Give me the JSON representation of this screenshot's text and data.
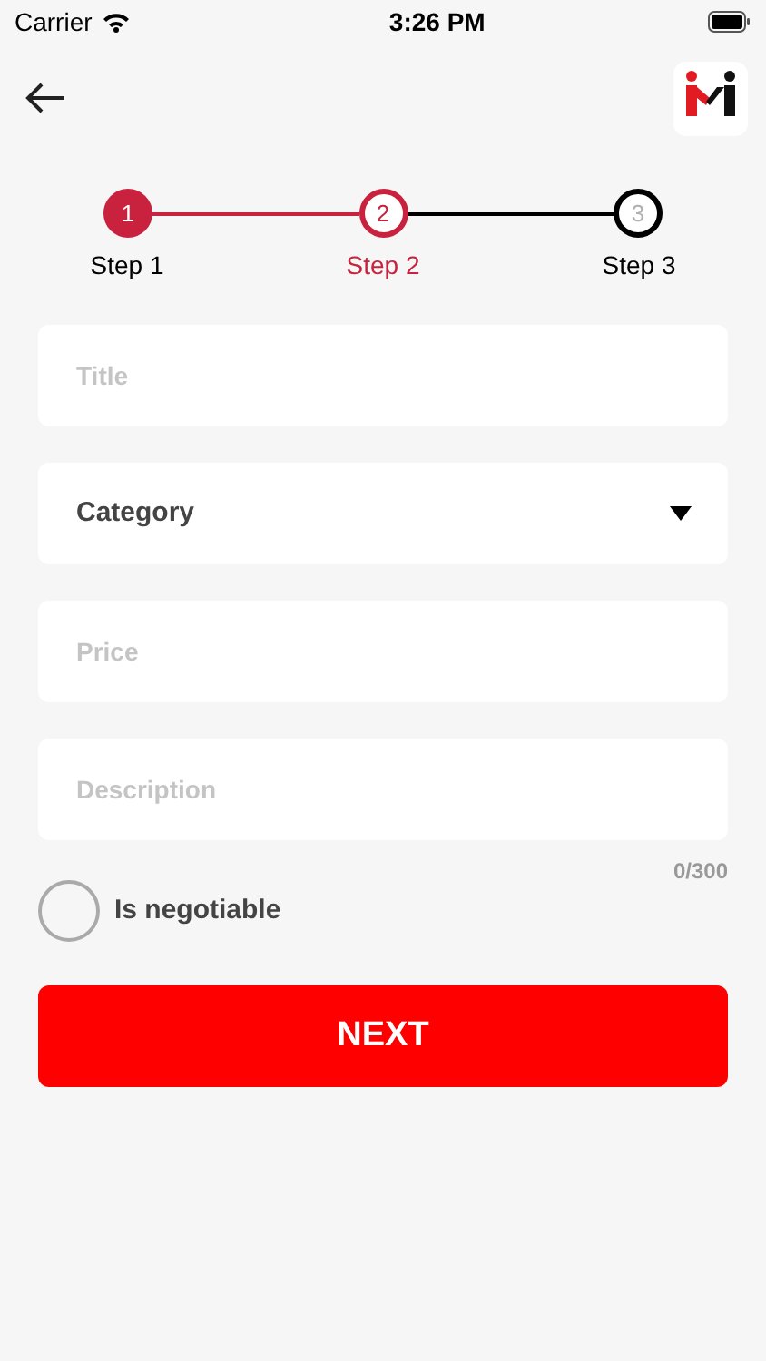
{
  "status_bar": {
    "carrier": "Carrier",
    "time": "3:26 PM"
  },
  "steps": [
    {
      "number": "1",
      "label": "Step 1",
      "kind": "done"
    },
    {
      "number": "2",
      "label": "Step 2",
      "kind": "current"
    },
    {
      "number": "3",
      "label": "Step 3",
      "kind": "upcoming"
    }
  ],
  "fields": [
    {
      "kind": "text",
      "placeholder": "Title"
    },
    {
      "kind": "select",
      "value": "Category"
    },
    {
      "kind": "text",
      "placeholder": "Price"
    },
    {
      "kind": "text",
      "placeholder": "Description"
    }
  ],
  "description_counter": "0/300",
  "negotiable": {
    "label": "Is negotiable",
    "checked": false
  },
  "next_button": "NEXT"
}
